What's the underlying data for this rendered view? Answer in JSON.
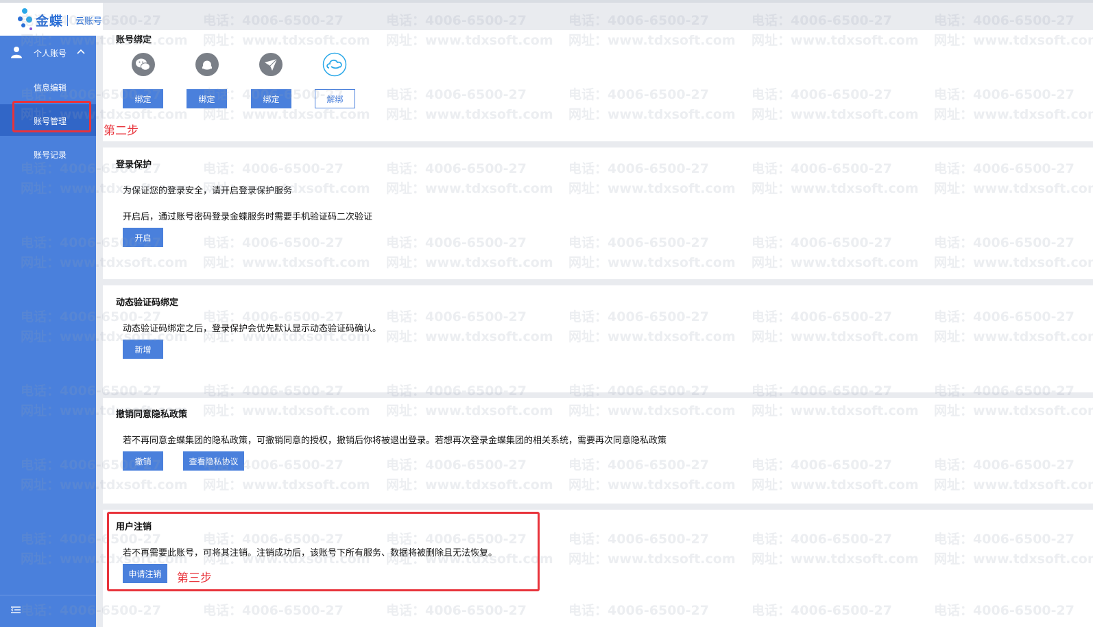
{
  "brand": {
    "name": "金蝶",
    "sub": "云账号"
  },
  "sidebar": {
    "group_label": "个人账号",
    "items": [
      {
        "label": "信息编辑"
      },
      {
        "label": "账号管理"
      },
      {
        "label": "账号记录"
      }
    ]
  },
  "account_binding": {
    "title": "账号绑定",
    "services": [
      {
        "icon": "wechat-icon",
        "button": "绑定"
      },
      {
        "icon": "qq-icon",
        "button": "绑定"
      },
      {
        "icon": "paper-plane-icon",
        "button": "绑定"
      },
      {
        "icon": "cloud-icon",
        "button": "解绑"
      }
    ]
  },
  "login_protection": {
    "title": "登录保护",
    "line1": "为保证您的登录安全，请开启登录保护服务",
    "line2": "开启后，通过账号密码登录金蝶服务时需要手机验证码二次验证",
    "button": "开启"
  },
  "dynamic_code": {
    "title": "动态验证码绑定",
    "text": "动态验证码绑定之后，登录保护会优先默认显示动态验证码确认。",
    "button": "新增"
  },
  "privacy": {
    "title": "撤销同意隐私政策",
    "text": "若不再同意金蝶集团的隐私政策，可撤销同意的授权，撤销后你将被退出登录。若想再次登录金蝶集团的相关系统，需要再次同意隐私政策",
    "revoke_button": "撤销",
    "view_button": "查看隐私协议"
  },
  "deregister": {
    "title": "用户注销",
    "text": "若不再需要此账号，可将其注销。注销成功后，该账号下所有服务、数据将被删除且无法恢复。",
    "button": "申请注销"
  },
  "annotations": {
    "step2": "第二步",
    "step3": "第三步"
  },
  "watermark": {
    "phone": "电话：4006-6500-27",
    "site": "网址：www.tdxsoft.com"
  },
  "colors": {
    "accent": "#4a80dc",
    "sidebar_active": "#3166c7",
    "annotation": "#e8333b"
  }
}
